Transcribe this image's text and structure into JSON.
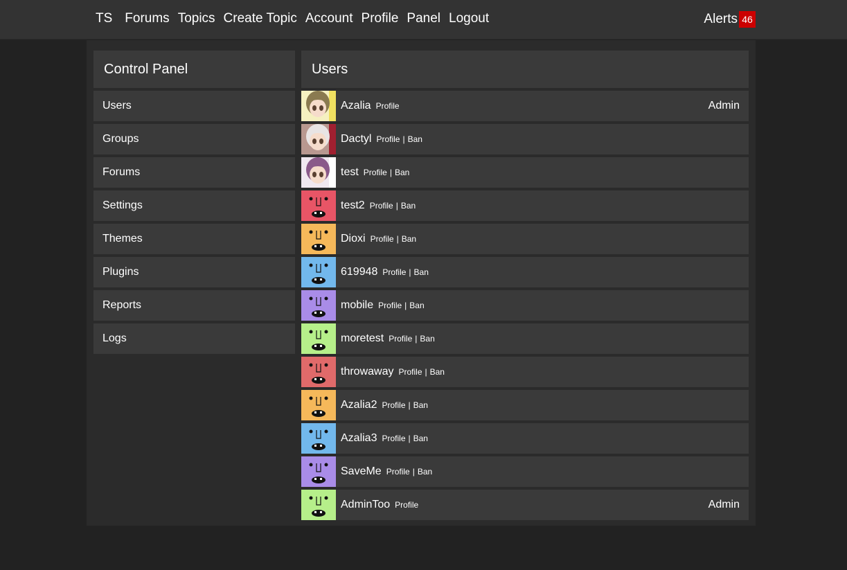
{
  "nav": {
    "brand": "TS",
    "links": [
      "Forums",
      "Topics",
      "Create Topic",
      "Account",
      "Profile",
      "Panel",
      "Logout"
    ],
    "alerts_label": "Alerts",
    "alerts_count": "46"
  },
  "sidebar": {
    "title": "Control Panel",
    "items": [
      "Users",
      "Groups",
      "Forums",
      "Settings",
      "Themes",
      "Plugins",
      "Reports",
      "Logs"
    ]
  },
  "users": {
    "title": "Users",
    "profile_label": "Profile",
    "ban_label": "Ban",
    "separator": "|",
    "rows": [
      {
        "name": "Azalia",
        "tag": "Admin",
        "ban": false,
        "avatar_color": "#f5f0c0",
        "avatar_kind": "anime-green"
      },
      {
        "name": "Dactyl",
        "tag": "",
        "ban": true,
        "avatar_color": "#b89890",
        "avatar_kind": "anime-white"
      },
      {
        "name": "test",
        "tag": "",
        "ban": true,
        "avatar_color": "#f0e8f0",
        "avatar_kind": "anime-purple"
      },
      {
        "name": "test2",
        "tag": "",
        "ban": true,
        "avatar_color": "#e85566",
        "avatar_kind": "face"
      },
      {
        "name": "Dioxi",
        "tag": "",
        "ban": true,
        "avatar_color": "#f5b85a",
        "avatar_kind": "face"
      },
      {
        "name": "619948",
        "tag": "",
        "ban": true,
        "avatar_color": "#72b8ec",
        "avatar_kind": "face"
      },
      {
        "name": "mobile",
        "tag": "",
        "ban": true,
        "avatar_color": "#a98ce8",
        "avatar_kind": "face"
      },
      {
        "name": "moretest",
        "tag": "",
        "ban": true,
        "avatar_color": "#b6ef8a",
        "avatar_kind": "face"
      },
      {
        "name": "throwaway",
        "tag": "",
        "ban": true,
        "avatar_color": "#e06a6a",
        "avatar_kind": "face"
      },
      {
        "name": "Azalia2",
        "tag": "",
        "ban": true,
        "avatar_color": "#f5b85a",
        "avatar_kind": "face"
      },
      {
        "name": "Azalia3",
        "tag": "",
        "ban": true,
        "avatar_color": "#72b8ec",
        "avatar_kind": "face"
      },
      {
        "name": "SaveMe",
        "tag": "",
        "ban": true,
        "avatar_color": "#a98ce8",
        "avatar_kind": "face"
      },
      {
        "name": "AdminToo",
        "tag": "Admin",
        "ban": false,
        "avatar_color": "#b6ef8a",
        "avatar_kind": "face"
      }
    ]
  }
}
